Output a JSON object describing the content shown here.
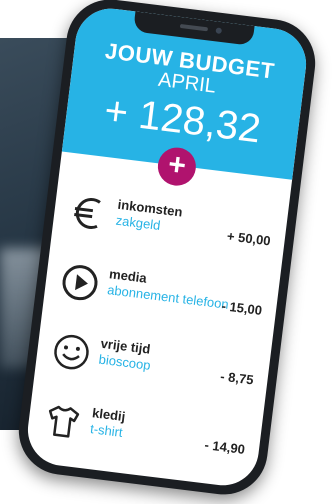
{
  "budget": {
    "title": "JOUW BUDGET",
    "month": "APRIL",
    "amount": "+ 128,32",
    "add_label": "+"
  },
  "items": [
    {
      "name": "inkomsten",
      "sub": "zakgeld",
      "value": "+ 50,00",
      "icon": "euro-icon"
    },
    {
      "name": "media",
      "sub": "abonnement telefoon",
      "value": "- 15,00",
      "icon": "play-icon"
    },
    {
      "name": "vrije tijd",
      "sub": "bioscoop",
      "value": "- 8,75",
      "icon": "smiley-icon"
    },
    {
      "name": "kledij",
      "sub": "t-shirt",
      "value": "- 14,90",
      "icon": "tshirt-icon"
    }
  ],
  "colors": {
    "header": "#27b3e5",
    "accent_button": "#b0136e",
    "subtitle_text": "#27b3e5"
  }
}
